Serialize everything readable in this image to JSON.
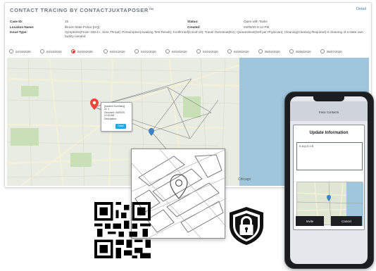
{
  "header": {
    "title": "CONTACT TRACING BY CONTACTJUXTAPOSER™",
    "detail_link": "Detail"
  },
  "case": {
    "case_id_label": "Case ID:",
    "case_id_value": "15",
    "location_label": "Location Name:",
    "location_value": "Illinois State Police [HQ]",
    "status_label": "Status:",
    "status_value": "Open with Tasks",
    "created_label": "Created:",
    "created_value": "04/08/20 8:14 PM",
    "issue_label": "Issue Type:",
    "issue_value": "Symptoms(Fever 100.4+, Sore Throat); Presumptive(Awaiting Test Result); Confirmed(Covid-19); Travel Overseas(EU); Quarantined(Self per Physician); Cleaning(Cleaning Required) is cleaning of a state own facility needed"
  },
  "dates": [
    {
      "label": "04/18/2020",
      "selected": false
    },
    {
      "label": "04/19/2020",
      "selected": false
    },
    {
      "label": "04/20/2020",
      "selected": true
    },
    {
      "label": "04/21/2020",
      "selected": false
    },
    {
      "label": "04/22/2020",
      "selected": false
    },
    {
      "label": "04/23/2020",
      "selected": false
    },
    {
      "label": "04/24/2020",
      "selected": false
    },
    {
      "label": "04/25/2020",
      "selected": false
    },
    {
      "label": "05/04/2020",
      "selected": false
    },
    {
      "label": "05/06/2020",
      "selected": false
    },
    {
      "label": "05/07/2020",
      "selected": false
    }
  ],
  "map_popup": {
    "line1": "[Incident Summary]",
    "line2": "ID: 1",
    "line3": "Occurred: 04/20/20 12:00 AM",
    "line4": "Description:",
    "button": "Detail"
  },
  "map_labels": {
    "city": "Chicago"
  },
  "phone": {
    "header": "Face Contacts",
    "sheet_title": "Update Information",
    "text_value": "n.a.p.n.c.k",
    "btn_left": "Invite",
    "btn_right": "Cancel"
  },
  "colors": {
    "accent": "#3b82c4",
    "selected_radio": "#dd3333",
    "lake": "#9fc6dc",
    "popup_button": "#2aa5d8",
    "map_pin": "#e8473d"
  },
  "icons": {
    "map_pin": "map-pin-icon",
    "qr": "qr-code-icon",
    "shield": "shield-lock-icon",
    "map_tile": "map-tile-icon"
  }
}
